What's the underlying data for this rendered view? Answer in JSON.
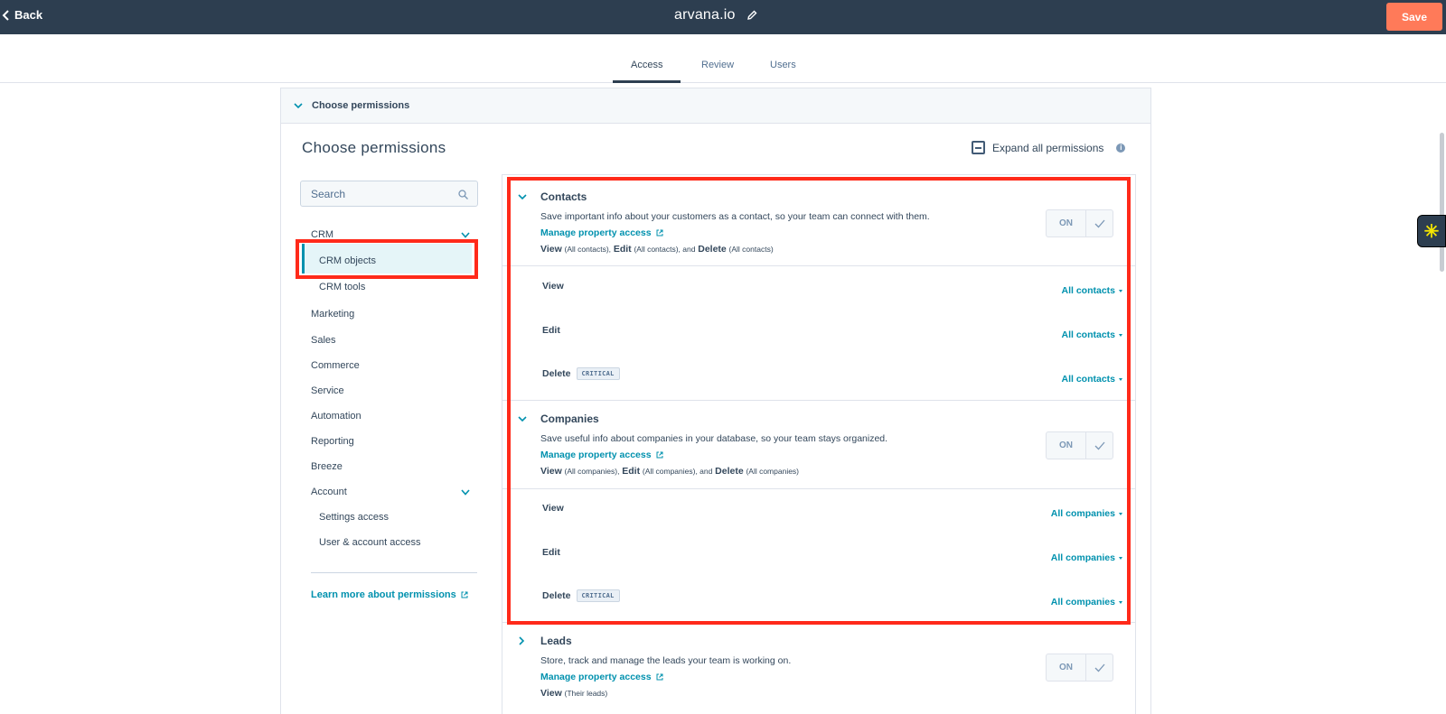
{
  "topbar": {
    "back_label": "Back",
    "title": "arvana.io",
    "save_label": "Save"
  },
  "tabs": [
    {
      "label": "Access",
      "active": true
    },
    {
      "label": "Review",
      "active": false
    },
    {
      "label": "Users",
      "active": false
    }
  ],
  "card": {
    "header_label": "Choose permissions",
    "title": "Choose permissions",
    "expand_all_label": "Expand all permissions"
  },
  "sidebar": {
    "search_placeholder": "Search",
    "items": [
      {
        "label": "CRM"
      },
      {
        "label": "CRM objects"
      },
      {
        "label": "CRM tools"
      },
      {
        "label": "Marketing"
      },
      {
        "label": "Sales"
      },
      {
        "label": "Commerce"
      },
      {
        "label": "Service"
      },
      {
        "label": "Automation"
      },
      {
        "label": "Reporting"
      },
      {
        "label": "Breeze"
      },
      {
        "label": "Account"
      },
      {
        "label": "Settings access"
      },
      {
        "label": "User & account access"
      }
    ],
    "learn_more": "Learn more about permissions"
  },
  "sections": [
    {
      "title": "Contacts",
      "description": "Save important info about your customers as a contact, so your team can connect with them.",
      "property_link": "Manage property access",
      "summary": {
        "view": "View",
        "view_scope": "(All contacts),",
        "edit": "Edit",
        "edit_scope": "(All contacts), and",
        "delete": "Delete",
        "delete_scope": "(All contacts)"
      },
      "toggle": "ON",
      "permissions": [
        {
          "label": "View",
          "value": "All contacts"
        },
        {
          "label": "Edit",
          "value": "All contacts"
        },
        {
          "label": "Delete",
          "badge": "CRITICAL",
          "value": "All contacts"
        }
      ]
    },
    {
      "title": "Companies",
      "description": "Save useful info about companies in your database, so your team stays organized.",
      "property_link": "Manage property access",
      "summary": {
        "view": "View",
        "view_scope": "(All companies),",
        "edit": "Edit",
        "edit_scope": "(All companies), and",
        "delete": "Delete",
        "delete_scope": "(All companies)"
      },
      "toggle": "ON",
      "permissions": [
        {
          "label": "View",
          "value": "All companies"
        },
        {
          "label": "Edit",
          "value": "All companies"
        },
        {
          "label": "Delete",
          "badge": "CRITICAL",
          "value": "All companies"
        }
      ]
    },
    {
      "title": "Leads",
      "description": "Store, track and manage the leads your team is working on.",
      "property_link": "Manage property access",
      "summary": {
        "view": "View",
        "view_scope": "(Their leads)"
      },
      "toggle": "ON"
    }
  ],
  "colors": {
    "topbar": "#2d3e50",
    "accent": "#0091ae",
    "save": "#ff7a59",
    "highlight": "#ff2a1a"
  }
}
